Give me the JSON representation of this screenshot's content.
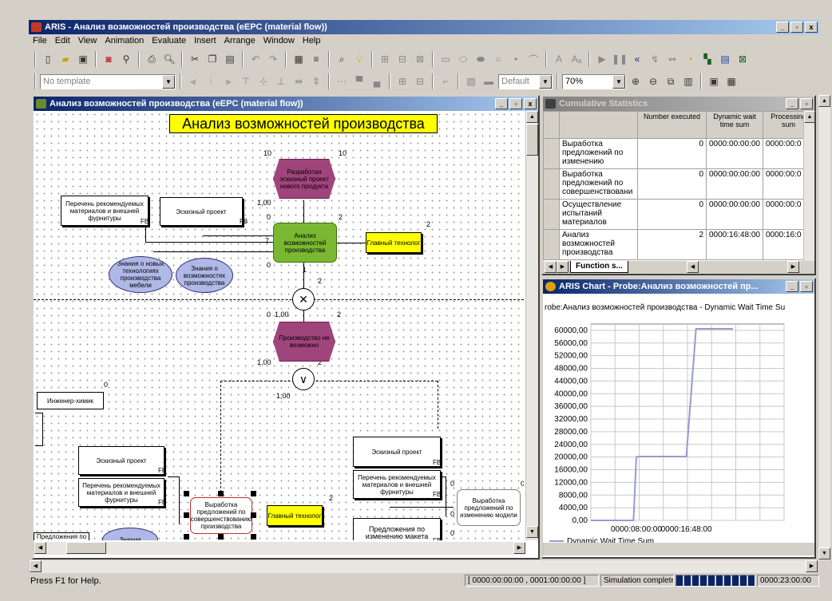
{
  "app": {
    "title": "ARIS - Анализ возможностей производства (eEPC (material flow))"
  },
  "window_controls": {
    "min": "_",
    "max": "▫",
    "close": "x"
  },
  "menu": [
    "File",
    "Edit",
    "View",
    "Animation",
    "Evaluate",
    "Insert",
    "Arrange",
    "Window",
    "Help"
  ],
  "toolbar2": {
    "template": "No template",
    "style": "Default",
    "zoom": "70%"
  },
  "model": {
    "title": "Анализ возможностей производства (eEPC (material flow))",
    "heading": "Анализ возможностей производства",
    "objects": {
      "event1": "Разработан эскизный проект нового продукта",
      "doc1": "Перечень рекомендуемых материалов и внешней фурнитуры",
      "doc2": "Эскизный проект",
      "func1": "Анализ возможностей производства",
      "role1": "Главный технолог",
      "know1": "Знания о новых технологиях производства мебели",
      "know2": "Знания о возможностях производства",
      "event2": "Производство не возможно",
      "role2": "Инженер-химик",
      "doc3": "Эскизный проект",
      "doc4": "Перечень рекомендуемых материалов и внешней фурнитуры",
      "func2": "Выработка предложений по совершенствованию производства",
      "role3": "Главный технолог",
      "doc5": "Эскизный проект",
      "doc6": "Перечень рекомендуемых материалов и внешней фурнитуры",
      "func3": "Выработка предложений по изменению модели",
      "doc7": "Предложения по изменению макета",
      "doc8": "Предложения по ...",
      "know3": "Знания",
      "fb": "FB"
    },
    "labels": {
      "n10": "10",
      "n2": "2",
      "n1_00": "1,00",
      "n0": "0",
      "n7": "7",
      "n1": "1",
      "n0_1_00": "0  1,00"
    }
  },
  "stats": {
    "title": "Cumulative Statistics",
    "headers": [
      "",
      "Number executed",
      "Dynamic wait time sum",
      "Processing sum"
    ],
    "rows": [
      {
        "name": "Выработка предложений по изменению",
        "executed": "0",
        "wait": "0000:00:00:00",
        "proc": "0000:00:0"
      },
      {
        "name": "Выработка предложений по совершенствовани",
        "executed": "0",
        "wait": "0000:00:00:00",
        "proc": "0000:00:0"
      },
      {
        "name": "Осуществление испытаний материалов",
        "executed": "0",
        "wait": "0000:00:00:00",
        "proc": "0000:00:0"
      },
      {
        "name": "Анализ возможностей производства",
        "executed": "2",
        "wait": "0000:16:48:00",
        "proc": "0000:16:0"
      }
    ],
    "tab": "Function s..."
  },
  "chart_window": {
    "title": "ARIS Chart - Probe:Анализ возможностей пр..."
  },
  "chart_data": {
    "type": "line",
    "title": "robe:Анализ возможностей производства - Dynamic Wait Time Su",
    "x_ticks": [
      "0000:08:00:00",
      "0000:16:48:00"
    ],
    "y_ticks": [
      "60000,00",
      "56000,00",
      "52000,00",
      "48000,00",
      "44000,00",
      "40000,00",
      "36000,00",
      "32000,00",
      "28000,00",
      "24000,00",
      "20000,00",
      "16000,00",
      "12000,00",
      "8000,00",
      "4000,00",
      "0,00"
    ],
    "ylim": [
      0,
      62000
    ],
    "xlim": [
      0,
      34
    ],
    "series": [
      {
        "name": "Dynamic Wait Time Sum",
        "color": "#9999d0",
        "x": [
          0,
          7.5,
          8.0,
          8.5,
          12,
          16.0,
          16.8,
          18.5,
          18.8,
          25
        ],
        "y": [
          0,
          0,
          20000,
          20160,
          20160,
          20160,
          20160,
          60480,
          60480,
          60480
        ]
      }
    ]
  },
  "status": {
    "help": "Press F1 for Help.",
    "time_range": "[ 0000:00:00:00 , 0001:00:00:00 ]",
    "sim": "Simulation complete",
    "clock": "0000:23:00:00"
  }
}
